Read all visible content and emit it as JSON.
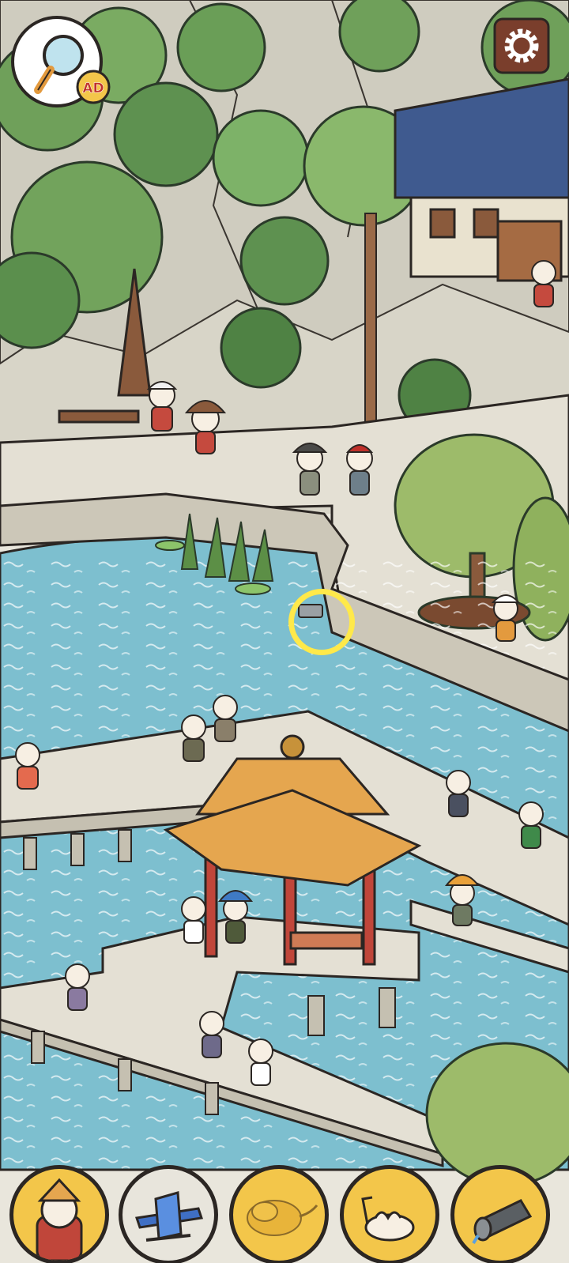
{
  "hud": {
    "hint_badge": "AD",
    "hint_icon": "magnifier-icon",
    "settings_icon": "gear-icon"
  },
  "targets": [
    {
      "name": "monk-figure",
      "found": true
    },
    {
      "name": "blue-seaplane",
      "found": false
    },
    {
      "name": "golden-cloud",
      "found": false
    },
    {
      "name": "camel",
      "found": false
    },
    {
      "name": "drain-pipe",
      "found": false
    }
  ],
  "colors": {
    "water": "#7dbfcf",
    "water_deep": "#6aaec2",
    "stone": "#e4e0d4",
    "roof": "#e5a64f",
    "pillar": "#c0463a",
    "foliage": "#6fa05a",
    "target_bg": "#f3c64a",
    "ring": "#ffe94a"
  }
}
